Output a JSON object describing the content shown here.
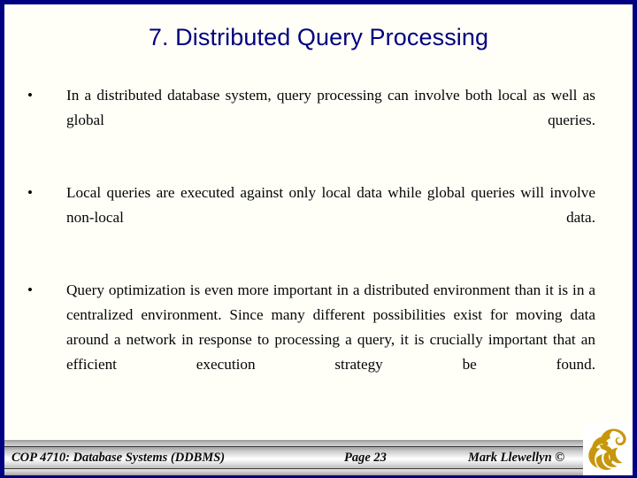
{
  "slide": {
    "title": "7. Distributed Query Processing",
    "title_color": "#000080",
    "background_color": "#FFFFF8",
    "frame_color": "#000080",
    "body_text_color": "#050505",
    "bullet_marker": "•",
    "bullets": [
      "In a distributed database system, query processing can involve both local as well as global queries.",
      "Local queries are executed against only local data while global queries will involve non-local data.",
      "Query optimization is even more important in a distributed environment than it is in a centralized environment.  Since many different possibilities exist for moving data around a network in response to processing a query, it is crucially important that an efficient execution strategy be found."
    ]
  },
  "footer": {
    "course": "COP 4710: Database Systems  (DDBMS)",
    "page": "Page 23",
    "author": "Mark Llewellyn ©",
    "logo_name": "ucf-pegasus-logo",
    "logo_color": "#C8960C"
  }
}
